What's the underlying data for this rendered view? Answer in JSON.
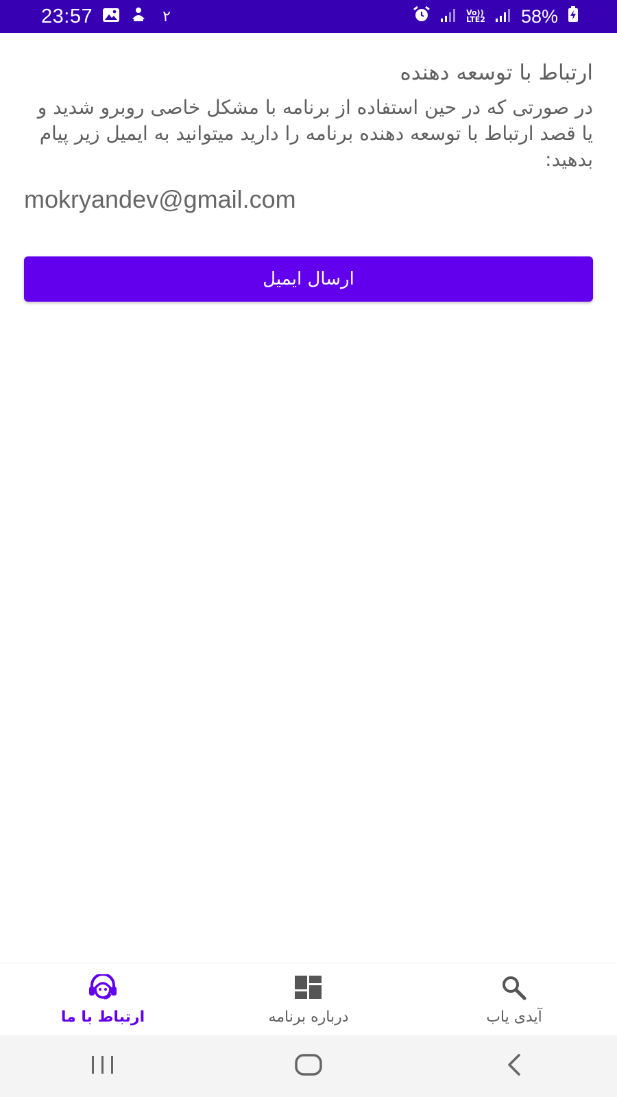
{
  "status_bar": {
    "time": "23:57",
    "notification_count": "۲",
    "network_label_top": "Vo))",
    "network_label_bottom": "LTE2",
    "battery": "58%"
  },
  "contact": {
    "title": "ارتباط با توسعه دهنده",
    "description": "در صورتی که در حین استفاده از برنامه با مشکل خاصی روبرو شدید و یا قصد ارتباط با توسعه دهنده برنامه را دارید میتوانید به ایمیل زیر پیام بدهید:",
    "email": "mokryandev@gmail.com",
    "send_button": "ارسال ایمیل"
  },
  "bottom_nav": {
    "items": [
      {
        "label": "ارتباط با ما",
        "icon": "support-agent-icon",
        "active": true
      },
      {
        "label": "درباره برنامه",
        "icon": "dashboard-icon",
        "active": false
      },
      {
        "label": "آیدی یاب",
        "icon": "search-icon",
        "active": false
      }
    ]
  },
  "colors": {
    "status_bar": "#3700b3",
    "primary": "#6200ee",
    "text_gray": "#5f5f5f",
    "icon_gray": "#555555"
  }
}
